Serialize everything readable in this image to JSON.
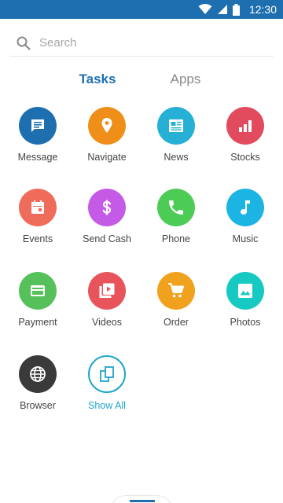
{
  "status_bar": {
    "time": "12:30",
    "background": "#1e6fb0"
  },
  "search": {
    "placeholder": "Search",
    "value": ""
  },
  "tabs": [
    {
      "label": "Tasks",
      "active": true
    },
    {
      "label": "Apps",
      "active": false
    }
  ],
  "tiles": [
    {
      "label": "Message",
      "icon": "message-icon",
      "color": "#1e6fb0"
    },
    {
      "label": "Navigate",
      "icon": "location-pin-icon",
      "color": "#ef8f1a"
    },
    {
      "label": "News",
      "icon": "newspaper-icon",
      "color": "#27b0d6"
    },
    {
      "label": "Stocks",
      "icon": "bar-chart-icon",
      "color": "#e14b5d"
    },
    {
      "label": "Events",
      "icon": "calendar-icon",
      "color": "#ef6b5a"
    },
    {
      "label": "Send Cash",
      "icon": "dollar-icon",
      "color": "#c55ae6"
    },
    {
      "label": "Phone",
      "icon": "phone-icon",
      "color": "#4ccc55"
    },
    {
      "label": "Music",
      "icon": "music-note-icon",
      "color": "#1cb4e2"
    },
    {
      "label": "Payment",
      "icon": "credit-card-icon",
      "color": "#56c05a"
    },
    {
      "label": "Videos",
      "icon": "video-play-icon",
      "color": "#e8545b"
    },
    {
      "label": "Order",
      "icon": "shopping-cart-icon",
      "color": "#f0a21e"
    },
    {
      "label": "Photos",
      "icon": "image-icon",
      "color": "#17c9c3"
    },
    {
      "label": "Browser",
      "icon": "globe-icon",
      "color": "#3a3a3a"
    },
    {
      "label": "Show All",
      "icon": "copy-pages-icon",
      "color": "#1fa5c9",
      "outline": true
    }
  ]
}
